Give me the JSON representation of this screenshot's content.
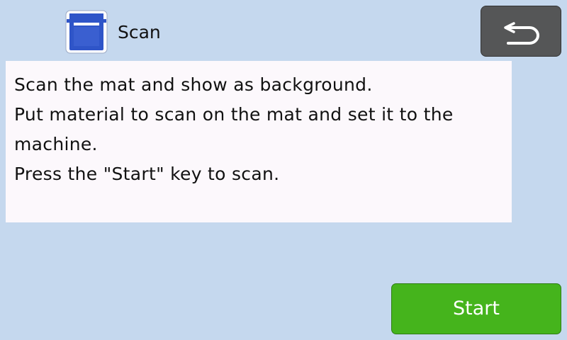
{
  "header": {
    "title": "Scan",
    "icon": "scanner-icon"
  },
  "back_button": {
    "icon": "return-arrow-icon"
  },
  "message": {
    "lines": [
      "Scan the mat and show as background.",
      "Put material to scan on the mat and set it to the",
      "machine.",
      "Press the \"Start\" key to scan."
    ]
  },
  "start_button": {
    "label": "Start"
  },
  "colors": {
    "background": "#c5d8ee",
    "panel": "#fcf8fc",
    "back_button": "#555657",
    "start_button": "#45b41c",
    "icon_blue": "#2f55c8"
  }
}
